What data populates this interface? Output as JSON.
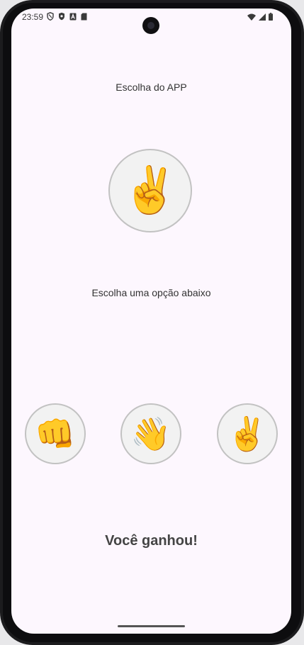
{
  "status_bar": {
    "time": "23:59",
    "left_icons": [
      "shield-outline-icon",
      "shield-icon",
      "a-box-icon",
      "sd-card-icon"
    ],
    "right_icons": [
      "wifi-icon",
      "cell-signal-icon",
      "battery-icon"
    ]
  },
  "game": {
    "app_choice_label": "Escolha do APP",
    "app_choice_emoji": "✌️",
    "app_choice_icon": "victory-hand-icon",
    "prompt": "Escolha uma opção abaixo",
    "options": [
      {
        "name": "rock",
        "emoji": "👊",
        "icon": "fist-icon"
      },
      {
        "name": "paper",
        "emoji": "👋",
        "icon": "open-hand-icon"
      },
      {
        "name": "scissors",
        "emoji": "✌️",
        "icon": "victory-hand-icon"
      }
    ],
    "result": "Você ganhou!"
  },
  "colors": {
    "screen_background": "#fdf7fe",
    "circle_fill": "#f2f2f2",
    "circle_border": "#c2c2c2",
    "text": "#333333",
    "result_text": "#444444"
  }
}
